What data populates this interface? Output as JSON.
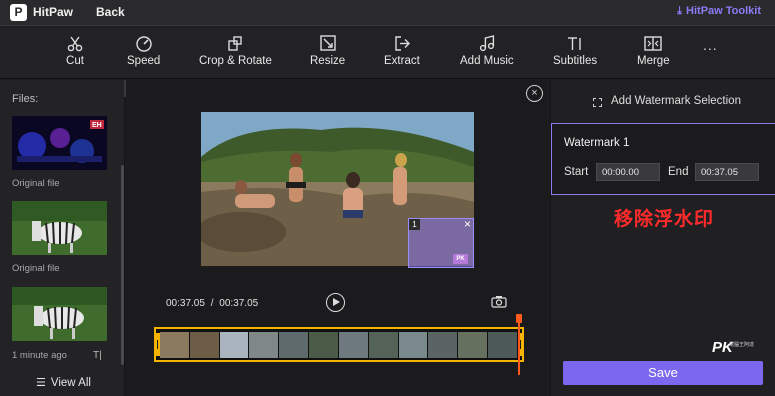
{
  "app": {
    "name": "HitPaw",
    "back": "Back",
    "toolkit": "HitPaw Toolkit"
  },
  "toolbar": {
    "items": [
      "Cut",
      "Speed",
      "Crop & Rotate",
      "Resize",
      "Extract",
      "Add Music",
      "Subtitles",
      "Merge"
    ],
    "more": "..."
  },
  "files": {
    "label": "Files:",
    "captions": [
      "Original file",
      "Original file",
      "1 minute ago"
    ],
    "view_all": "View All",
    "subtitle_icon": "T|"
  },
  "preview": {
    "current_time": "00:37.05",
    "separator": "/",
    "total_time": "00:37.05",
    "watermark_number": "1",
    "watermark_logo": "PK"
  },
  "right_panel": {
    "add_selection": "Add Watermark Selection",
    "watermark_title": "Watermark 1",
    "start_label": "Start",
    "start_value": "00:00.00",
    "end_label": "End",
    "end_value": "00:37.05",
    "overlay_caption": "移除浮水印",
    "brand": "PK",
    "brand_sub": "電腦王阿達",
    "save": "Save"
  },
  "colors": {
    "accent": "#7b68ee",
    "timeline": "#f4b400",
    "playhead": "#ff5b1f",
    "caption": "#ff2b2b"
  }
}
